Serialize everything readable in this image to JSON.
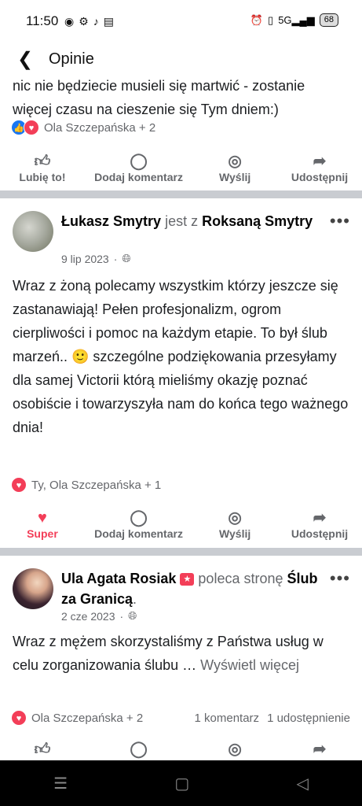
{
  "status_bar": {
    "time": "11:50",
    "left_icons": [
      "messenger-icon",
      "gear-icon",
      "tiktok-icon",
      "calendar-icon"
    ],
    "right_icons": [
      "alarm-icon",
      "vibrate-icon",
      "signal-5g-icon"
    ],
    "network": "5G",
    "battery": "68"
  },
  "header": {
    "title": "Opinie",
    "back_icon": "arrow-left-icon"
  },
  "top_post": {
    "cut_text_line1": "nic nie będziecie musieli się martwić - zostanie",
    "cut_text_line2": "więcej czasu na cieszenie się Tym dniem:)",
    "reactions_text": "Ola Szczepańska + 2",
    "actions": {
      "like": "Lubię to!",
      "comment": "Dodaj komentarz",
      "send": "Wyślij",
      "share": "Udostępnij"
    }
  },
  "post1": {
    "author": "Łukasz Smytry",
    "with_text": "jest z",
    "with_author": "Roksaną Smytry",
    "date": "9 lip 2023",
    "privacy_icon": "globe-icon",
    "text": "Wraz z żoną polecamy wszystkim którzy jeszcze się zastanawiają! Pełen profesjonalizm, ogrom cierpliwości i pomoc na każdym etapie. To był ślub marzeń.. 🙂 szczególne podziękowania przesyłamy dla samej Victorii którą mieliśmy okazję poznać osobiście i towarzyszyła nam do końca tego ważnego dnia!",
    "reactions_text": "Ty, Ola Szczepańska + 1",
    "actions": {
      "super": "Super",
      "comment": "Dodaj komentarz",
      "send": "Wyślij",
      "share": "Udostępnij"
    }
  },
  "post2": {
    "author": "Ula Agata Rosiak",
    "recommends_text": "poleca stronę",
    "page_name": "Ślub za Granicą",
    "date": "2 cze 2023",
    "privacy_icon": "globe-icon",
    "text": "Wraz z mężem skorzystaliśmy z Państwa usług w celu zorganizowania ślubu …",
    "see_more": "Wyświetl więcej",
    "reactions_text": "Ola Szczepańska + 2",
    "comments_count": "1 komentarz",
    "shares_count": "1 udostępnienie"
  },
  "nav_bar": {
    "icons": [
      "menu-icon",
      "home-square-icon",
      "back-triangle-icon"
    ]
  },
  "colors": {
    "accent_blue": "#1877f2",
    "love_red": "#f33e58",
    "muted_gray": "#65676b",
    "divider_gray": "#c9ccd1"
  }
}
